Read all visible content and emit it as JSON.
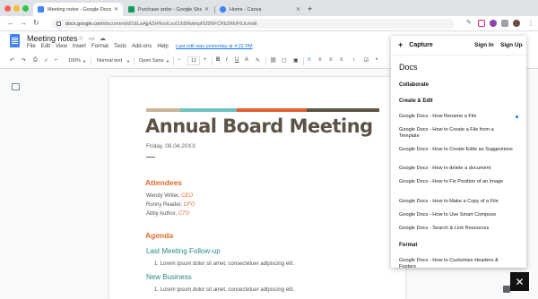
{
  "browser": {
    "tabs": [
      {
        "title": "Meeting notes - Google Docs",
        "active": true,
        "favicon_color": "#4285f4"
      },
      {
        "title": "Purchase order - Google Sheets",
        "active": false,
        "favicon_color": "#0f9d58"
      },
      {
        "title": "Home - Canva",
        "active": false,
        "favicon_color": "#3b82f6"
      }
    ],
    "url_host": "docs.google.com",
    "url_path": "/document/d/1ELaAjjAZHNvsILezOJd9fwbnpf9J5NFCRb2RkIF9Jc/edit"
  },
  "doc_app": {
    "title": "Meeting notes",
    "menus": [
      "File",
      "Edit",
      "View",
      "Insert",
      "Format",
      "Tools",
      "Add-ons",
      "Help"
    ],
    "last_edit": "Last edit was yesterday at 4:22 PM",
    "toolbar": {
      "zoom": "100%",
      "style": "Normal text",
      "font": "Open Sans",
      "font_size": "12"
    }
  },
  "document": {
    "heading": "Annual Board Meeting",
    "date": "Friday, 09.04.20XX",
    "attendees_heading": "Attendees",
    "attendees": [
      {
        "name": "Wendy Writer, ",
        "role": "CEO"
      },
      {
        "name": "Ronny Reader, ",
        "role": "CFO"
      },
      {
        "name": "Abby Author, ",
        "role": "CTO"
      }
    ],
    "agenda_heading": "Agenda",
    "agenda_items": [
      {
        "title": "Last Meeting Follow-up",
        "item": "1.   Lorem ipsum dolor sit amet, consectetuer adipiscing elit."
      },
      {
        "title": "New Business",
        "item": "1.   Lorem ipsum dolor sit amet, consectetuer adipiscing elit."
      }
    ],
    "accent_colors": [
      "#c8b59a",
      "#6fc0c0",
      "#e3612e",
      "#5c5346"
    ]
  },
  "panel": {
    "capture_label": "Capture",
    "sign_in": "Sign In",
    "sign_up": "Sign Up",
    "title": "Docs",
    "section_collaborate": "Collaborate",
    "section_create": "Create & Edit",
    "create_items": [
      "Google Docs - How Rename a File",
      "Google Docs - How to Create a File from a Template",
      "Google Docs - How to Create Edits as Suggestions",
      "Google Docs - How to delete a document",
      "Google Docs - How to Fix Position of an Image",
      "Google Docs - How to Make a Copy of a File",
      "Google Docs - How to Use Smart Compose",
      "Google Docs - Search & Link Resources"
    ],
    "section_format": "Format",
    "format_items": [
      "Google Docs - How to Customize Headers & Footers"
    ]
  }
}
